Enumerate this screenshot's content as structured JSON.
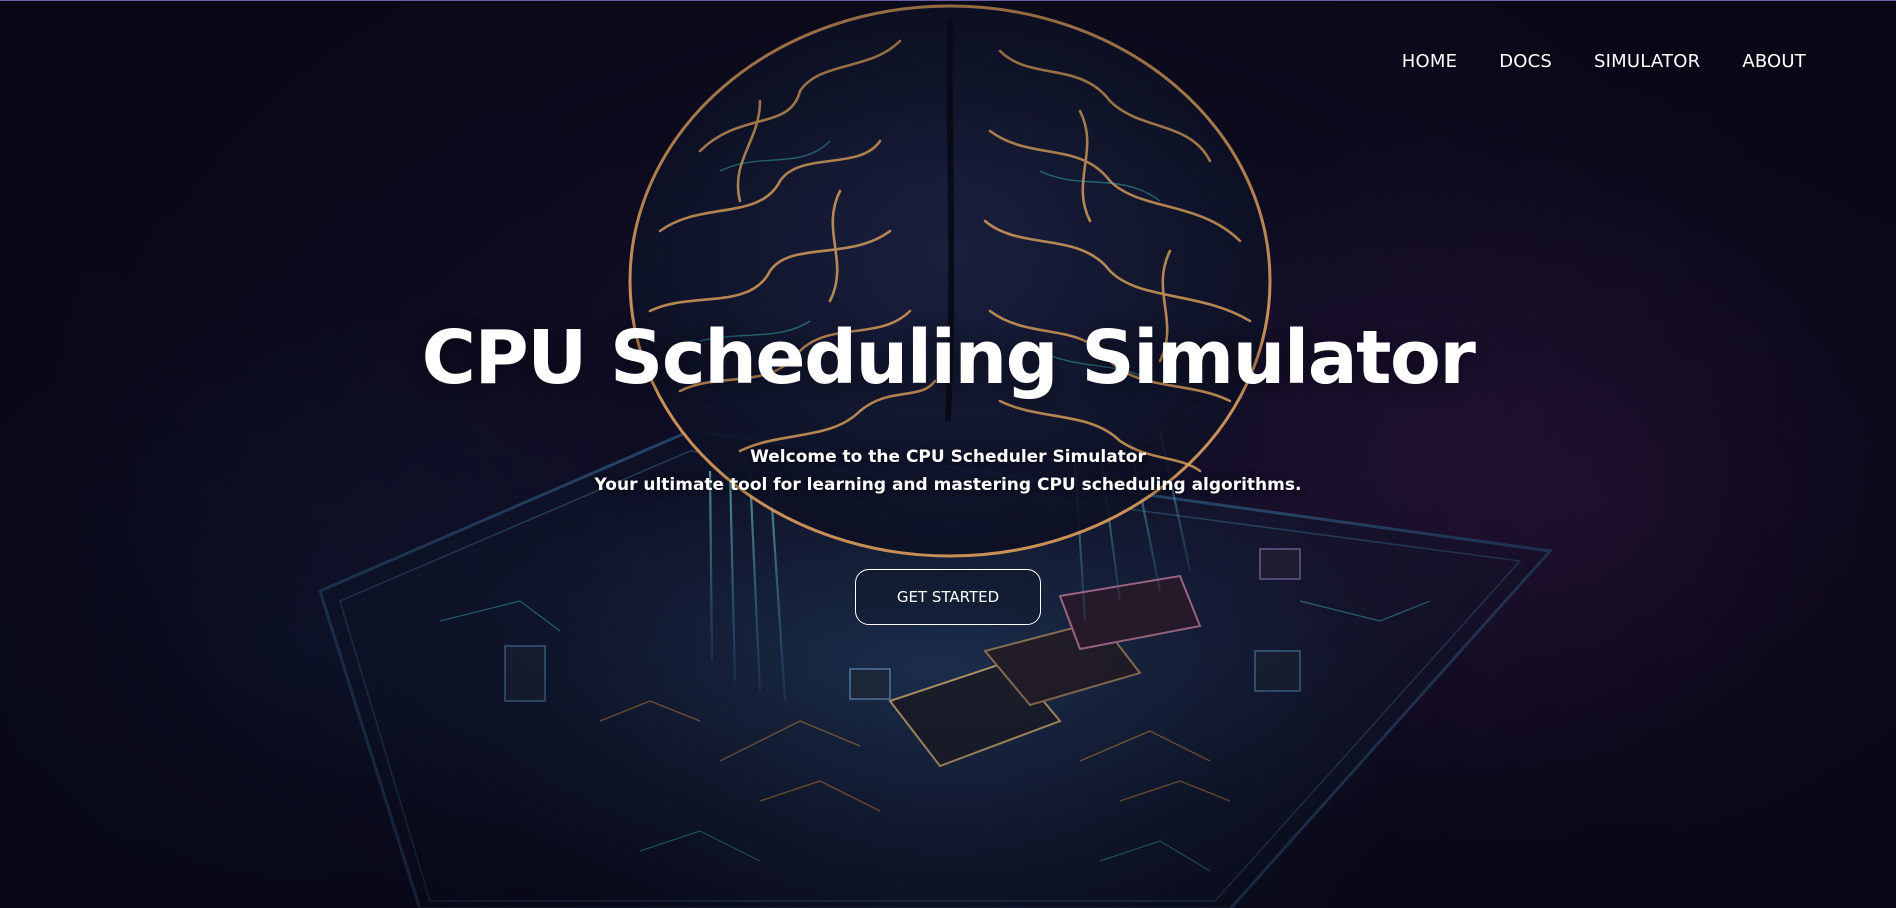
{
  "nav": {
    "items": [
      {
        "label": "HOME"
      },
      {
        "label": "DOCS"
      },
      {
        "label": "SIMULATOR"
      },
      {
        "label": "ABOUT"
      }
    ]
  },
  "hero": {
    "title": "CPU Scheduling Simulator",
    "subtitle_line1": "Welcome to the CPU Scheduler Simulator",
    "subtitle_line2": "Your ultimate tool for learning and mastering CPU scheduling algorithms.",
    "cta_label": "GET STARTED"
  },
  "background": {
    "image_description_icon": "brain-on-circuit-board-illustration",
    "colors": {
      "base": "#0d0c1f",
      "brain_glow": "#e8a25a",
      "circuit_cyan": "#3fc7c7",
      "accent_purple": "#6b5fa8"
    }
  }
}
